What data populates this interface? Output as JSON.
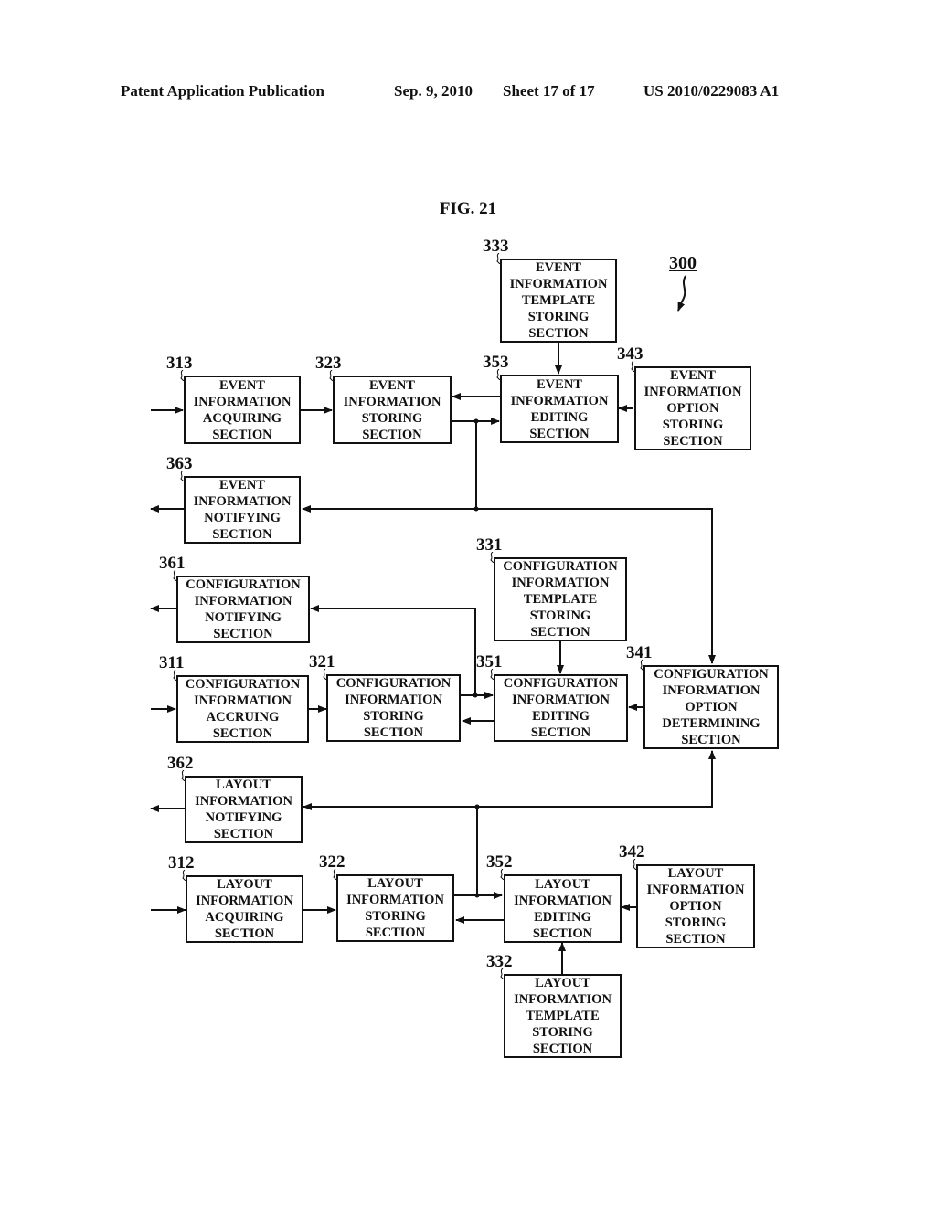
{
  "header": {
    "publication": "Patent Application Publication",
    "date": "Sep. 9, 2010",
    "sheet": "Sheet 17 of 17",
    "number": "US 2010/0229083 A1"
  },
  "figure": {
    "title": "FIG. 21",
    "system_ref": "300"
  },
  "blocks": {
    "b333": {
      "ref": "333",
      "lines": [
        "EVENT",
        "INFORMATION",
        "TEMPLATE",
        "STORING",
        "SECTION"
      ]
    },
    "b313": {
      "ref": "313",
      "lines": [
        "EVENT",
        "INFORMATION",
        "ACQUIRING",
        "SECTION"
      ]
    },
    "b323": {
      "ref": "323",
      "lines": [
        "EVENT",
        "INFORMATION",
        "STORING",
        "SECTION"
      ]
    },
    "b353": {
      "ref": "353",
      "lines": [
        "EVENT",
        "INFORMATION",
        "EDITING",
        "SECTION"
      ]
    },
    "b343": {
      "ref": "343",
      "lines": [
        "EVENT",
        "INFORMATION",
        "OPTION",
        "STORING",
        "SECTION"
      ]
    },
    "b363": {
      "ref": "363",
      "lines": [
        "EVENT",
        "INFORMATION",
        "NOTIFYING",
        "SECTION"
      ]
    },
    "b361": {
      "ref": "361",
      "lines": [
        "CONFIGURATION",
        "INFORMATION",
        "NOTIFYING",
        "SECTION"
      ]
    },
    "b331": {
      "ref": "331",
      "lines": [
        "CONFIGURATION",
        "INFORMATION",
        "TEMPLATE",
        "STORING",
        "SECTION"
      ]
    },
    "b311": {
      "ref": "311",
      "lines": [
        "CONFIGURATION",
        "INFORMATION",
        "ACCRUING",
        "SECTION"
      ]
    },
    "b321": {
      "ref": "321",
      "lines": [
        "CONFIGURATION",
        "INFORMATION",
        "STORING",
        "SECTION"
      ]
    },
    "b351": {
      "ref": "351",
      "lines": [
        "CONFIGURATION",
        "INFORMATION",
        "EDITING",
        "SECTION"
      ]
    },
    "b341": {
      "ref": "341",
      "lines": [
        "CONFIGURATION",
        "INFORMATION",
        "OPTION",
        "DETERMINING",
        "SECTION"
      ]
    },
    "b362": {
      "ref": "362",
      "lines": [
        "LAYOUT",
        "INFORMATION",
        "NOTIFYING",
        "SECTION"
      ]
    },
    "b312": {
      "ref": "312",
      "lines": [
        "LAYOUT",
        "INFORMATION",
        "ACQUIRING",
        "SECTION"
      ]
    },
    "b322": {
      "ref": "322",
      "lines": [
        "LAYOUT",
        "INFORMATION",
        "STORING",
        "SECTION"
      ]
    },
    "b352": {
      "ref": "352",
      "lines": [
        "LAYOUT",
        "INFORMATION",
        "EDITING",
        "SECTION"
      ]
    },
    "b342": {
      "ref": "342",
      "lines": [
        "LAYOUT",
        "INFORMATION",
        "OPTION",
        "STORING",
        "SECTION"
      ]
    },
    "b332": {
      "ref": "332",
      "lines": [
        "LAYOUT",
        "INFORMATION",
        "TEMPLATE",
        "STORING",
        "SECTION"
      ]
    }
  }
}
